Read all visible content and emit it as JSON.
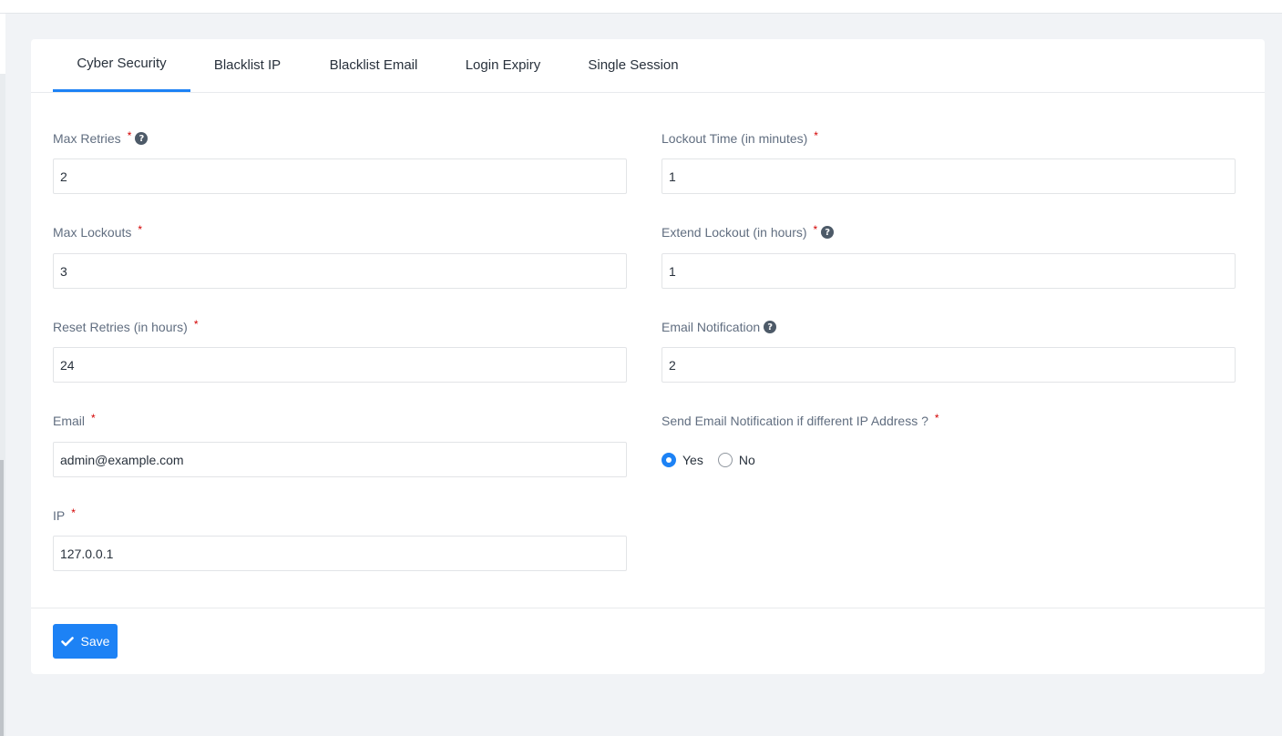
{
  "tabs": [
    {
      "label": "Cyber Security",
      "active": true
    },
    {
      "label": "Blacklist IP",
      "active": false
    },
    {
      "label": "Blacklist Email",
      "active": false
    },
    {
      "label": "Login Expiry",
      "active": false
    },
    {
      "label": "Single Session",
      "active": false
    }
  ],
  "form": {
    "max_retries": {
      "label": "Max Retries",
      "value": "2"
    },
    "lockout_time": {
      "label": "Lockout Time (in minutes)",
      "value": "1"
    },
    "max_lockouts": {
      "label": "Max Lockouts",
      "value": "3"
    },
    "extend_lockout": {
      "label": "Extend Lockout (in hours)",
      "value": "1"
    },
    "reset_retries": {
      "label": "Reset Retries (in hours)",
      "value": "24"
    },
    "email_notification": {
      "label": "Email Notification",
      "value": "2"
    },
    "email": {
      "label": "Email",
      "value": "admin@example.com"
    },
    "send_notification": {
      "label": "Send Email Notification if different IP Address ?",
      "options": [
        "Yes",
        "No"
      ],
      "selected": "Yes"
    },
    "ip": {
      "label": "IP",
      "value": "127.0.0.1"
    },
    "required_mark": "*",
    "help_glyph": "?"
  },
  "save_label": "Save",
  "colors": {
    "accent": "#1d82f5",
    "required": "#d30000"
  }
}
